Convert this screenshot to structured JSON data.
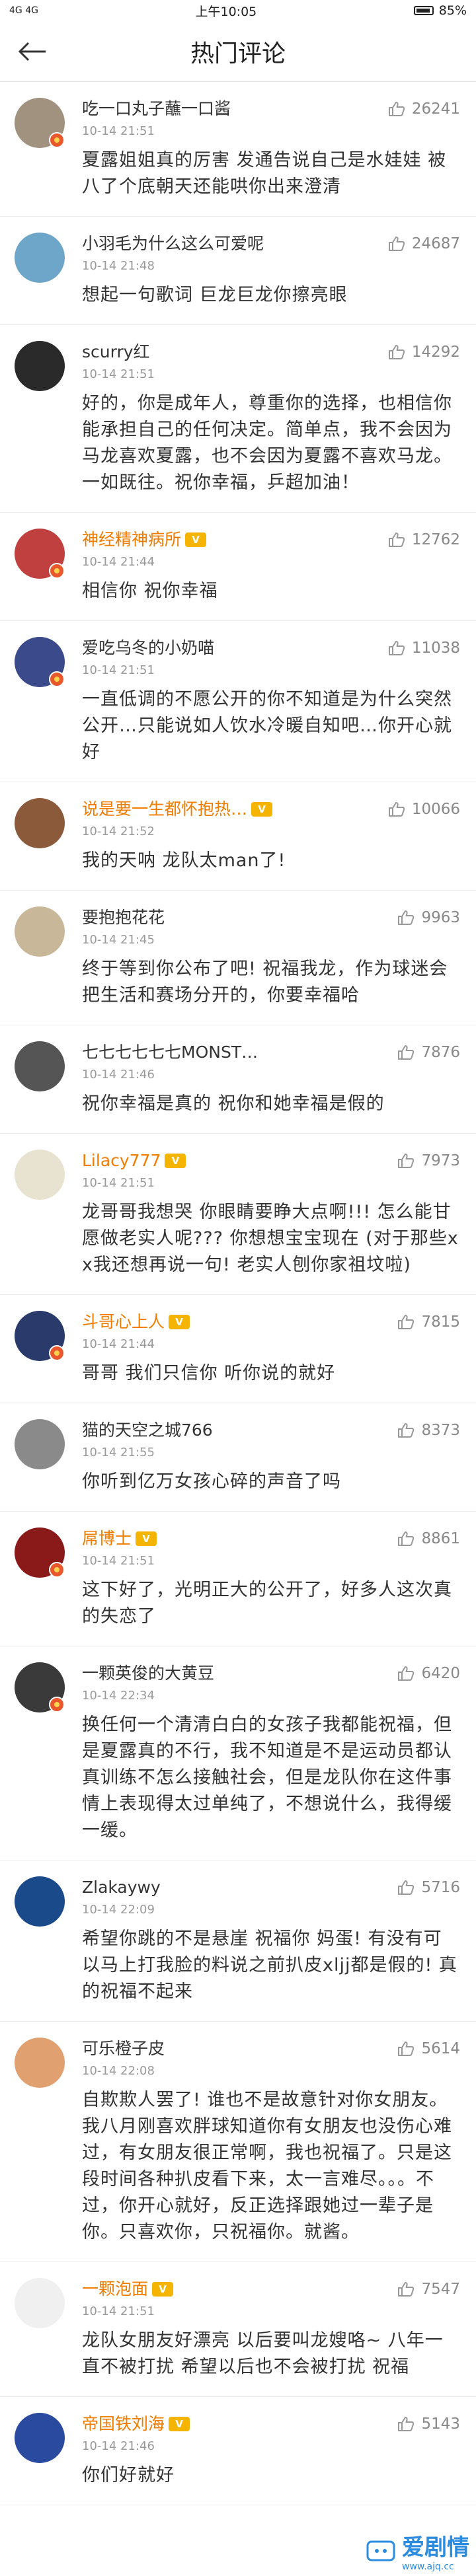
{
  "status": {
    "left": "4G 4G",
    "time": "上午10:05",
    "battery": "85%"
  },
  "nav": {
    "title": "热门评论"
  },
  "comments": [
    {
      "user": "吃一口丸子蘸一口酱",
      "likes": "26241",
      "time": "10-14 21:51",
      "text": "夏露姐姐真的厉害 发通告说自己是水娃娃 被八了个底朝天还能哄你出来澄清",
      "avatar_color": "#a0927f",
      "vip": false,
      "badge": true
    },
    {
      "user": "小羽毛为什么这么可爱呢",
      "likes": "24687",
      "time": "10-14 21:48",
      "text": "想起一句歌词 巨龙巨龙你擦亮眼",
      "avatar_color": "#6ea6c9",
      "vip": false,
      "badge": false
    },
    {
      "user": "scurry红",
      "likes": "14292",
      "time": "10-14 21:51",
      "text": "好的，你是成年人，尊重你的选择，也相信你能承担自己的任何决定。简单点，我不会因为马龙喜欢夏露，也不会因为夏露不喜欢马龙。一如既往。祝你幸福，乒超加油！",
      "avatar_color": "#2a2a2a",
      "vip": false,
      "badge": false
    },
    {
      "user": "神经精神病所",
      "likes": "12762",
      "time": "10-14 21:44",
      "text": "相信你 祝你幸福",
      "avatar_color": "#c04040",
      "vip": true,
      "badge": true
    },
    {
      "user": "爱吃乌冬的小奶喵",
      "likes": "11038",
      "time": "10-14 21:51",
      "text": "一直低调的不愿公开的你不知道是为什么突然公开…只能说如人饮水冷暖自知吧…你开心就好",
      "avatar_color": "#3a4a8a",
      "vip": false,
      "badge": true
    },
    {
      "user": "说是要一生都怀抱热…",
      "likes": "10066",
      "time": "10-14 21:52",
      "text": "我的天呐 龙队太man了!",
      "avatar_color": "#8a5a3a",
      "vip": true,
      "badge": false
    },
    {
      "user": "要抱抱花花",
      "likes": "9963",
      "time": "10-14 21:45",
      "text": "终于等到你公布了吧! 祝福我龙，作为球迷会把生活和赛场分开的，你要幸福哈",
      "avatar_color": "#c9b79a",
      "vip": false,
      "badge": false
    },
    {
      "user": "七七七七七七MONST…",
      "likes": "7876",
      "time": "10-14 21:46",
      "text": "祝你幸福是真的 祝你和她幸福是假的",
      "avatar_color": "#555555",
      "vip": false,
      "badge": false
    },
    {
      "user": "Lilacy777",
      "likes": "7973",
      "time": "10-14 21:51",
      "text": "龙哥哥我想哭 你眼睛要睁大点啊!!! 怎么能甘愿做老实人呢??? 你想想宝宝现在 (对于那些xx我还想再说一句! 老实人刨你家祖坟啦)",
      "avatar_color": "#e8e2d0",
      "vip": true,
      "badge": false
    },
    {
      "user": "斗哥心上人",
      "likes": "7815",
      "time": "10-14 21:44",
      "text": "哥哥 我们只信你 听你说的就好",
      "avatar_color": "#2a3a6a",
      "vip": true,
      "badge": true
    },
    {
      "user": "猫的天空之城766",
      "likes": "8373",
      "time": "10-14 21:55",
      "text": "你听到亿万女孩心碎的声音了吗",
      "avatar_color": "#8a8a8a",
      "vip": false,
      "badge": false
    },
    {
      "user": "屌博士",
      "likes": "8861",
      "time": "10-14 21:51",
      "text": "这下好了，光明正大的公开了，好多人这次真的失恋了",
      "avatar_color": "#8a1a1a",
      "vip": true,
      "badge": true
    },
    {
      "user": "一颗英俊的大黄豆",
      "likes": "6420",
      "time": "10-14 22:34",
      "text": "换任何一个清清白白的女孩子我都能祝福，但是夏露真的不行，我不知道是不是运动员都认真训练不怎么接触社会，但是龙队你在这件事情上表现得太过单纯了，不想说什么，我得缓一缓。",
      "avatar_color": "#3a3a3a",
      "vip": false,
      "badge": true
    },
    {
      "user": "Zlakaywy",
      "likes": "5716",
      "time": "10-14 22:09",
      "text": "希望你跳的不是悬崖 祝福你 妈蛋! 有没有可以马上打我脸的料说之前扒皮xljj都是假的! 真的祝福不起来",
      "avatar_color": "#1a4a8a",
      "vip": false,
      "badge": false
    },
    {
      "user": "可乐橙子皮",
      "likes": "5614",
      "time": "10-14 22:08",
      "text": "自欺欺人罢了! 谁也不是故意针对你女朋友。我八月刚喜欢胖球知道你有女朋友也没伤心难过，有女朋友很正常啊，我也祝福了。只是这段时间各种扒皮看下来，太一言难尽。。。不过，你开心就好，反正选择跟她过一辈子是你。只喜欢你，只祝福你。就酱。",
      "avatar_color": "#e0a070",
      "vip": false,
      "badge": false
    },
    {
      "user": "一颗泡面",
      "likes": "7547",
      "time": "10-14 21:51",
      "text": "龙队女朋友好漂亮 以后要叫龙嫂咯~ 八年一直不被打扰 希望以后也不会被打扰 祝福",
      "avatar_color": "#f0f0f0",
      "vip": true,
      "badge": false
    },
    {
      "user": "帝国铁刘海",
      "likes": "5143",
      "time": "10-14 21:46",
      "text": "你们好就好",
      "avatar_color": "#2a4aa0",
      "vip": true,
      "badge": false
    }
  ],
  "watermark": {
    "brand": "爱剧情",
    "url": "www.ajq.cc"
  }
}
